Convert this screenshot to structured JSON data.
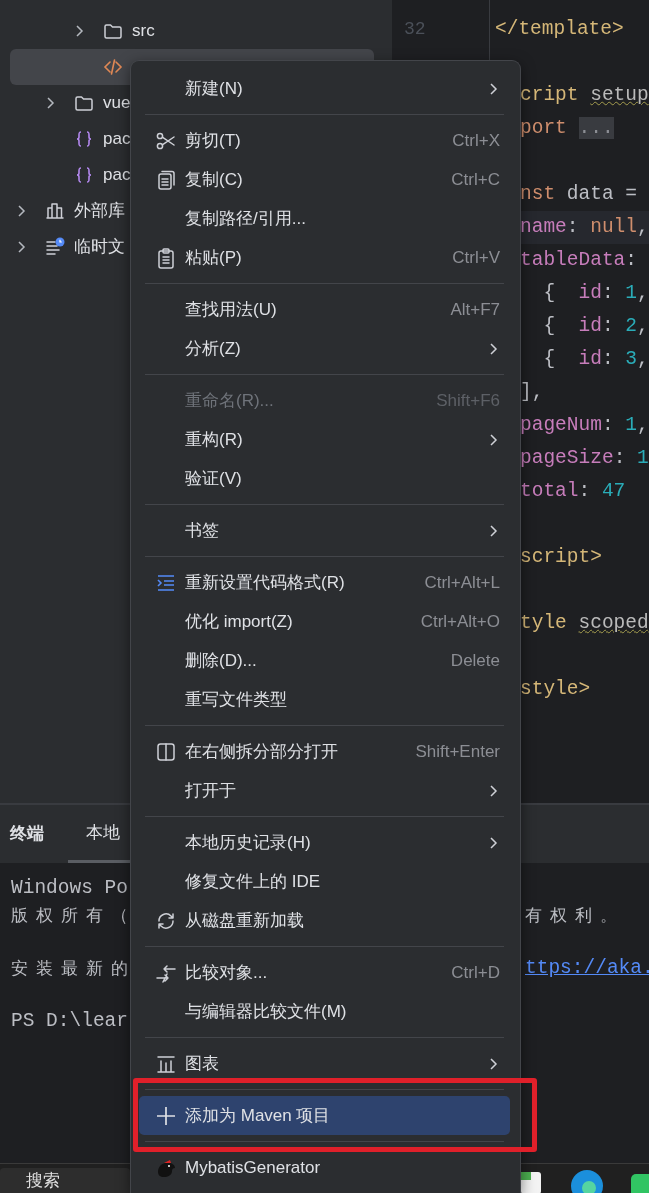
{
  "project_tree": [
    {
      "children": [
        {
          "children": [
            {
              "label": "src",
              "kind": "folder",
              "expandable": true,
              "selected": false
            },
            {
              "kind": "code-file",
              "expandable": false,
              "selected": true
            }
          ]
        },
        {
          "label": "vue",
          "kind": "folder",
          "expandable": true,
          "selected": false
        },
        {
          "label": "pac",
          "kind": "json-file",
          "expandable": false,
          "selected": false
        },
        {
          "label": "pac",
          "kind": "json-file",
          "expandable": false,
          "selected": false
        }
      ]
    },
    {
      "label": "外部库",
      "kind": "library",
      "expandable": true,
      "selected": false
    },
    {
      "label": "临时文",
      "kind": "scratches",
      "expandable": true,
      "selected": false
    }
  ],
  "editor": {
    "line_numbers": [
      "32"
    ],
    "lines": [
      {
        "kind": "full",
        "current": false,
        "tokens": [
          {
            "kind": "tag",
            "text": "</template>"
          }
        ]
      },
      {
        "kind": "blank"
      },
      {
        "kind": "cut",
        "current": false,
        "tokens": [
          {
            "kind": "tag",
            "text": "cript"
          },
          {
            "kind": "attr",
            "text": "setup"
          }
        ]
      },
      {
        "kind": "cut",
        "current": false,
        "tokens": [
          {
            "kind": "keyword",
            "text": "port"
          },
          {
            "kind": "fold",
            "text": "..."
          }
        ]
      },
      {
        "kind": "blank"
      },
      {
        "kind": "cut",
        "current": false,
        "tokens": [
          {
            "kind": "keyword",
            "text": "nst"
          },
          {
            "kind": "plain",
            "text": " data ="
          }
        ]
      },
      {
        "kind": "cut",
        "current": true,
        "tokens": [
          {
            "kind": "prop",
            "text": "name"
          },
          {
            "kind": "plain",
            "text": ": "
          },
          {
            "kind": "keyword",
            "text": "null"
          },
          {
            "kind": "plain",
            "text": ","
          }
        ]
      },
      {
        "kind": "cut",
        "current": false,
        "tokens": [
          {
            "kind": "prop",
            "text": "tableData"
          },
          {
            "kind": "plain",
            "text": ":"
          }
        ]
      },
      {
        "kind": "cut",
        "current": false,
        "tokens": [
          {
            "kind": "plain",
            "text": "  {  "
          },
          {
            "kind": "prop",
            "text": "id"
          },
          {
            "kind": "plain",
            "text": ": "
          },
          {
            "kind": "num",
            "text": "1"
          },
          {
            "kind": "plain",
            "text": ","
          }
        ]
      },
      {
        "kind": "cut",
        "current": false,
        "tokens": [
          {
            "kind": "plain",
            "text": "  {  "
          },
          {
            "kind": "prop",
            "text": "id"
          },
          {
            "kind": "plain",
            "text": ": "
          },
          {
            "kind": "num",
            "text": "2"
          },
          {
            "kind": "plain",
            "text": ","
          }
        ]
      },
      {
        "kind": "cut",
        "current": false,
        "tokens": [
          {
            "kind": "plain",
            "text": "  {  "
          },
          {
            "kind": "prop",
            "text": "id"
          },
          {
            "kind": "plain",
            "text": ": "
          },
          {
            "kind": "num",
            "text": "3"
          },
          {
            "kind": "plain",
            "text": ","
          }
        ]
      },
      {
        "kind": "cut",
        "current": false,
        "tokens": [
          {
            "kind": "plain",
            "text": "],"
          }
        ]
      },
      {
        "kind": "cut",
        "current": false,
        "tokens": [
          {
            "kind": "prop",
            "text": "pageNum"
          },
          {
            "kind": "plain",
            "text": ": "
          },
          {
            "kind": "num",
            "text": "1"
          },
          {
            "kind": "plain",
            "text": ","
          }
        ]
      },
      {
        "kind": "cut",
        "current": false,
        "tokens": [
          {
            "kind": "prop",
            "text": "pageSize"
          },
          {
            "kind": "plain",
            "text": ": "
          },
          {
            "kind": "num",
            "text": "1"
          }
        ]
      },
      {
        "kind": "cut",
        "current": false,
        "tokens": [
          {
            "kind": "prop",
            "text": "total"
          },
          {
            "kind": "plain",
            "text": ": "
          },
          {
            "kind": "num",
            "text": "47"
          }
        ]
      },
      {
        "kind": "blank"
      },
      {
        "kind": "cut",
        "current": false,
        "tokens": [
          {
            "kind": "tag",
            "text": "script>"
          }
        ]
      },
      {
        "kind": "blank"
      },
      {
        "kind": "cut",
        "current": false,
        "tokens": [
          {
            "kind": "tag",
            "text": "tyle"
          },
          {
            "kind": "attr",
            "text": "scoped"
          }
        ]
      },
      {
        "kind": "blank"
      },
      {
        "kind": "cut",
        "current": false,
        "tokens": [
          {
            "kind": "tag",
            "text": "style>"
          }
        ]
      }
    ]
  },
  "terminal": {
    "title": "终端",
    "tabs": [
      {
        "label": "本地",
        "selected": true
      }
    ],
    "lines": [
      {
        "kind": "text",
        "left": "Windows Po"
      },
      {
        "kind": "cjk",
        "left": "版权所有（",
        "right": "有权利。"
      },
      {
        "kind": "blank"
      },
      {
        "kind": "cjk",
        "left": "安装最新的",
        "link": "ttps://aka."
      },
      {
        "kind": "blank"
      },
      {
        "kind": "text",
        "left": "PS D:\\lear"
      }
    ]
  },
  "context_menu": {
    "items": [
      {
        "kind": "plain",
        "label": "新建(N)",
        "submenu": true,
        "disabled": false,
        "selected": false
      },
      {
        "kind": "separator"
      },
      {
        "kind": "cut",
        "label": "剪切(T)",
        "shortcut": "Ctrl+X",
        "submenu": false,
        "disabled": false,
        "selected": false
      },
      {
        "kind": "copy",
        "label": "复制(C)",
        "shortcut": "Ctrl+C",
        "submenu": false,
        "disabled": false,
        "selected": false
      },
      {
        "kind": "plain",
        "label": "复制路径/引用...",
        "submenu": false,
        "disabled": false,
        "selected": false
      },
      {
        "kind": "paste",
        "label": "粘贴(P)",
        "shortcut": "Ctrl+V",
        "submenu": false,
        "disabled": false,
        "selected": false
      },
      {
        "kind": "separator"
      },
      {
        "kind": "plain",
        "label": "查找用法(U)",
        "shortcut": "Alt+F7",
        "submenu": false,
        "disabled": false,
        "selected": false
      },
      {
        "kind": "plain",
        "label": "分析(Z)",
        "submenu": true,
        "disabled": false,
        "selected": false
      },
      {
        "kind": "separator"
      },
      {
        "kind": "plain",
        "label": "重命名(R)...",
        "shortcut": "Shift+F6",
        "submenu": false,
        "disabled": true,
        "selected": false
      },
      {
        "kind": "plain",
        "label": "重构(R)",
        "submenu": true,
        "disabled": false,
        "selected": false
      },
      {
        "kind": "plain",
        "label": "验证(V)",
        "submenu": false,
        "disabled": false,
        "selected": false
      },
      {
        "kind": "separator"
      },
      {
        "kind": "plain",
        "label": "书签",
        "submenu": true,
        "disabled": false,
        "selected": false
      },
      {
        "kind": "separator"
      },
      {
        "kind": "format",
        "label": "重新设置代码格式(R)",
        "shortcut": "Ctrl+Alt+L",
        "submenu": false,
        "disabled": false,
        "selected": false
      },
      {
        "kind": "plain",
        "label": "优化 import(Z)",
        "shortcut": "Ctrl+Alt+O",
        "submenu": false,
        "disabled": false,
        "selected": false
      },
      {
        "kind": "plain",
        "label": "删除(D)...",
        "shortcut": "Delete",
        "submenu": false,
        "disabled": false,
        "selected": false
      },
      {
        "kind": "plain",
        "label": "重写文件类型",
        "submenu": false,
        "disabled": false,
        "selected": false
      },
      {
        "kind": "separator"
      },
      {
        "kind": "split",
        "label": "在右侧拆分部分打开",
        "shortcut": "Shift+Enter",
        "submenu": false,
        "disabled": false,
        "selected": false
      },
      {
        "kind": "plain",
        "label": "打开于",
        "submenu": true,
        "disabled": false,
        "selected": false
      },
      {
        "kind": "separator"
      },
      {
        "kind": "plain",
        "label": "本地历史记录(H)",
        "submenu": true,
        "disabled": false,
        "selected": false
      },
      {
        "kind": "plain",
        "label": "修复文件上的 IDE",
        "submenu": false,
        "disabled": false,
        "selected": false
      },
      {
        "kind": "reload",
        "label": "从磁盘重新加载",
        "submenu": false,
        "disabled": false,
        "selected": false
      },
      {
        "kind": "separator"
      },
      {
        "kind": "compare",
        "label": "比较对象...",
        "shortcut": "Ctrl+D",
        "submenu": false,
        "disabled": false,
        "selected": false
      },
      {
        "kind": "plain",
        "label": "与编辑器比较文件(M)",
        "submenu": false,
        "disabled": false,
        "selected": false
      },
      {
        "kind": "separator"
      },
      {
        "kind": "chart",
        "label": "图表",
        "submenu": true,
        "disabled": false,
        "selected": false
      },
      {
        "kind": "separator"
      },
      {
        "kind": "add",
        "label": "添加为 Maven 项目",
        "submenu": false,
        "disabled": false,
        "selected": true
      },
      {
        "kind": "separator"
      },
      {
        "kind": "plugin",
        "label": "MybatisGenerator",
        "submenu": false,
        "disabled": false,
        "selected": false
      }
    ]
  },
  "taskbar": {
    "search": "搜索"
  }
}
